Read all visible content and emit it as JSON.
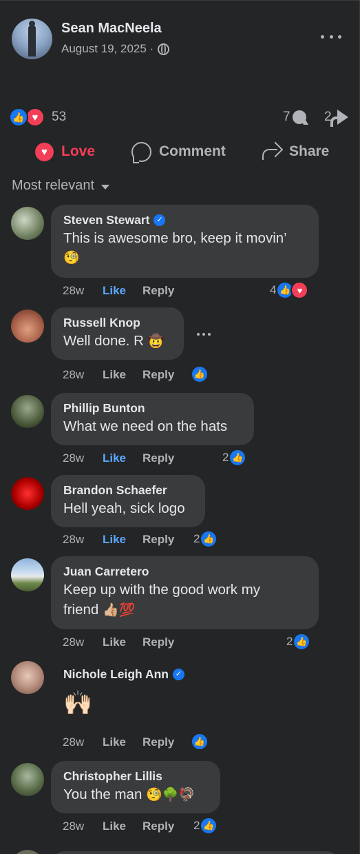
{
  "post": {
    "author": "Sean MacNeela",
    "date": "August 19, 2025 ·",
    "reaction_count": "53",
    "comment_count": "7",
    "share_count": "2"
  },
  "actions": {
    "love": "Love",
    "comment": "Comment",
    "share": "Share"
  },
  "filter": "Most relevant",
  "comments": [
    {
      "name": "Steven Stewart",
      "verified": true,
      "text": "This is awesome bro, keep it movin’",
      "emoji": "🧐",
      "time": "28w",
      "like": "Like",
      "reply": "Reply",
      "liked": true,
      "reactions": "4",
      "reaction_types": [
        "like",
        "love"
      ]
    },
    {
      "name": "Russell Knop",
      "verified": false,
      "text": "Well done. R",
      "emoji": "🤠",
      "time": "28w",
      "like": "Like",
      "reply": "Reply",
      "liked": false,
      "reactions": "",
      "reaction_types": [
        "like"
      ]
    },
    {
      "name": "Phillip Bunton",
      "verified": false,
      "text": "What we need on the hats",
      "emoji": "",
      "time": "28w",
      "like": "Like",
      "reply": "Reply",
      "liked": true,
      "reactions": "2",
      "reaction_types": [
        "like"
      ]
    },
    {
      "name": "Brandon Schaefer",
      "verified": false,
      "text": "Hell yeah, sick logo",
      "emoji": "",
      "time": "28w",
      "like": "Like",
      "reply": "Reply",
      "liked": true,
      "reactions": "2",
      "reaction_types": [
        "like"
      ]
    },
    {
      "name": "Juan Carretero",
      "verified": false,
      "text": "Keep up with the good work my",
      "text2": "friend",
      "emoji": "👍🏼💯",
      "time": "28w",
      "like": "Like",
      "reply": "Reply",
      "liked": false,
      "reactions": "2",
      "reaction_types": [
        "like"
      ]
    },
    {
      "name": "Nichole Leigh Ann",
      "verified": true,
      "text": "",
      "emoji": "🙌🏻",
      "time": "28w",
      "like": "Like",
      "reply": "Reply",
      "liked": false,
      "reactions": "",
      "reaction_types": [
        "like"
      ]
    },
    {
      "name": "Christopher Lillis",
      "verified": false,
      "text": "You the man",
      "emoji": "🧐🌳🦃",
      "time": "28w",
      "like": "Like",
      "reply": "Reply",
      "liked": false,
      "reactions": "2",
      "reaction_types": [
        "like"
      ]
    }
  ],
  "colors": {
    "background": "#242526",
    "bubble": "#3a3b3c",
    "like_blue": "#1877f2",
    "love_red": "#f33e58",
    "liked_text": "#5aa7ff"
  }
}
